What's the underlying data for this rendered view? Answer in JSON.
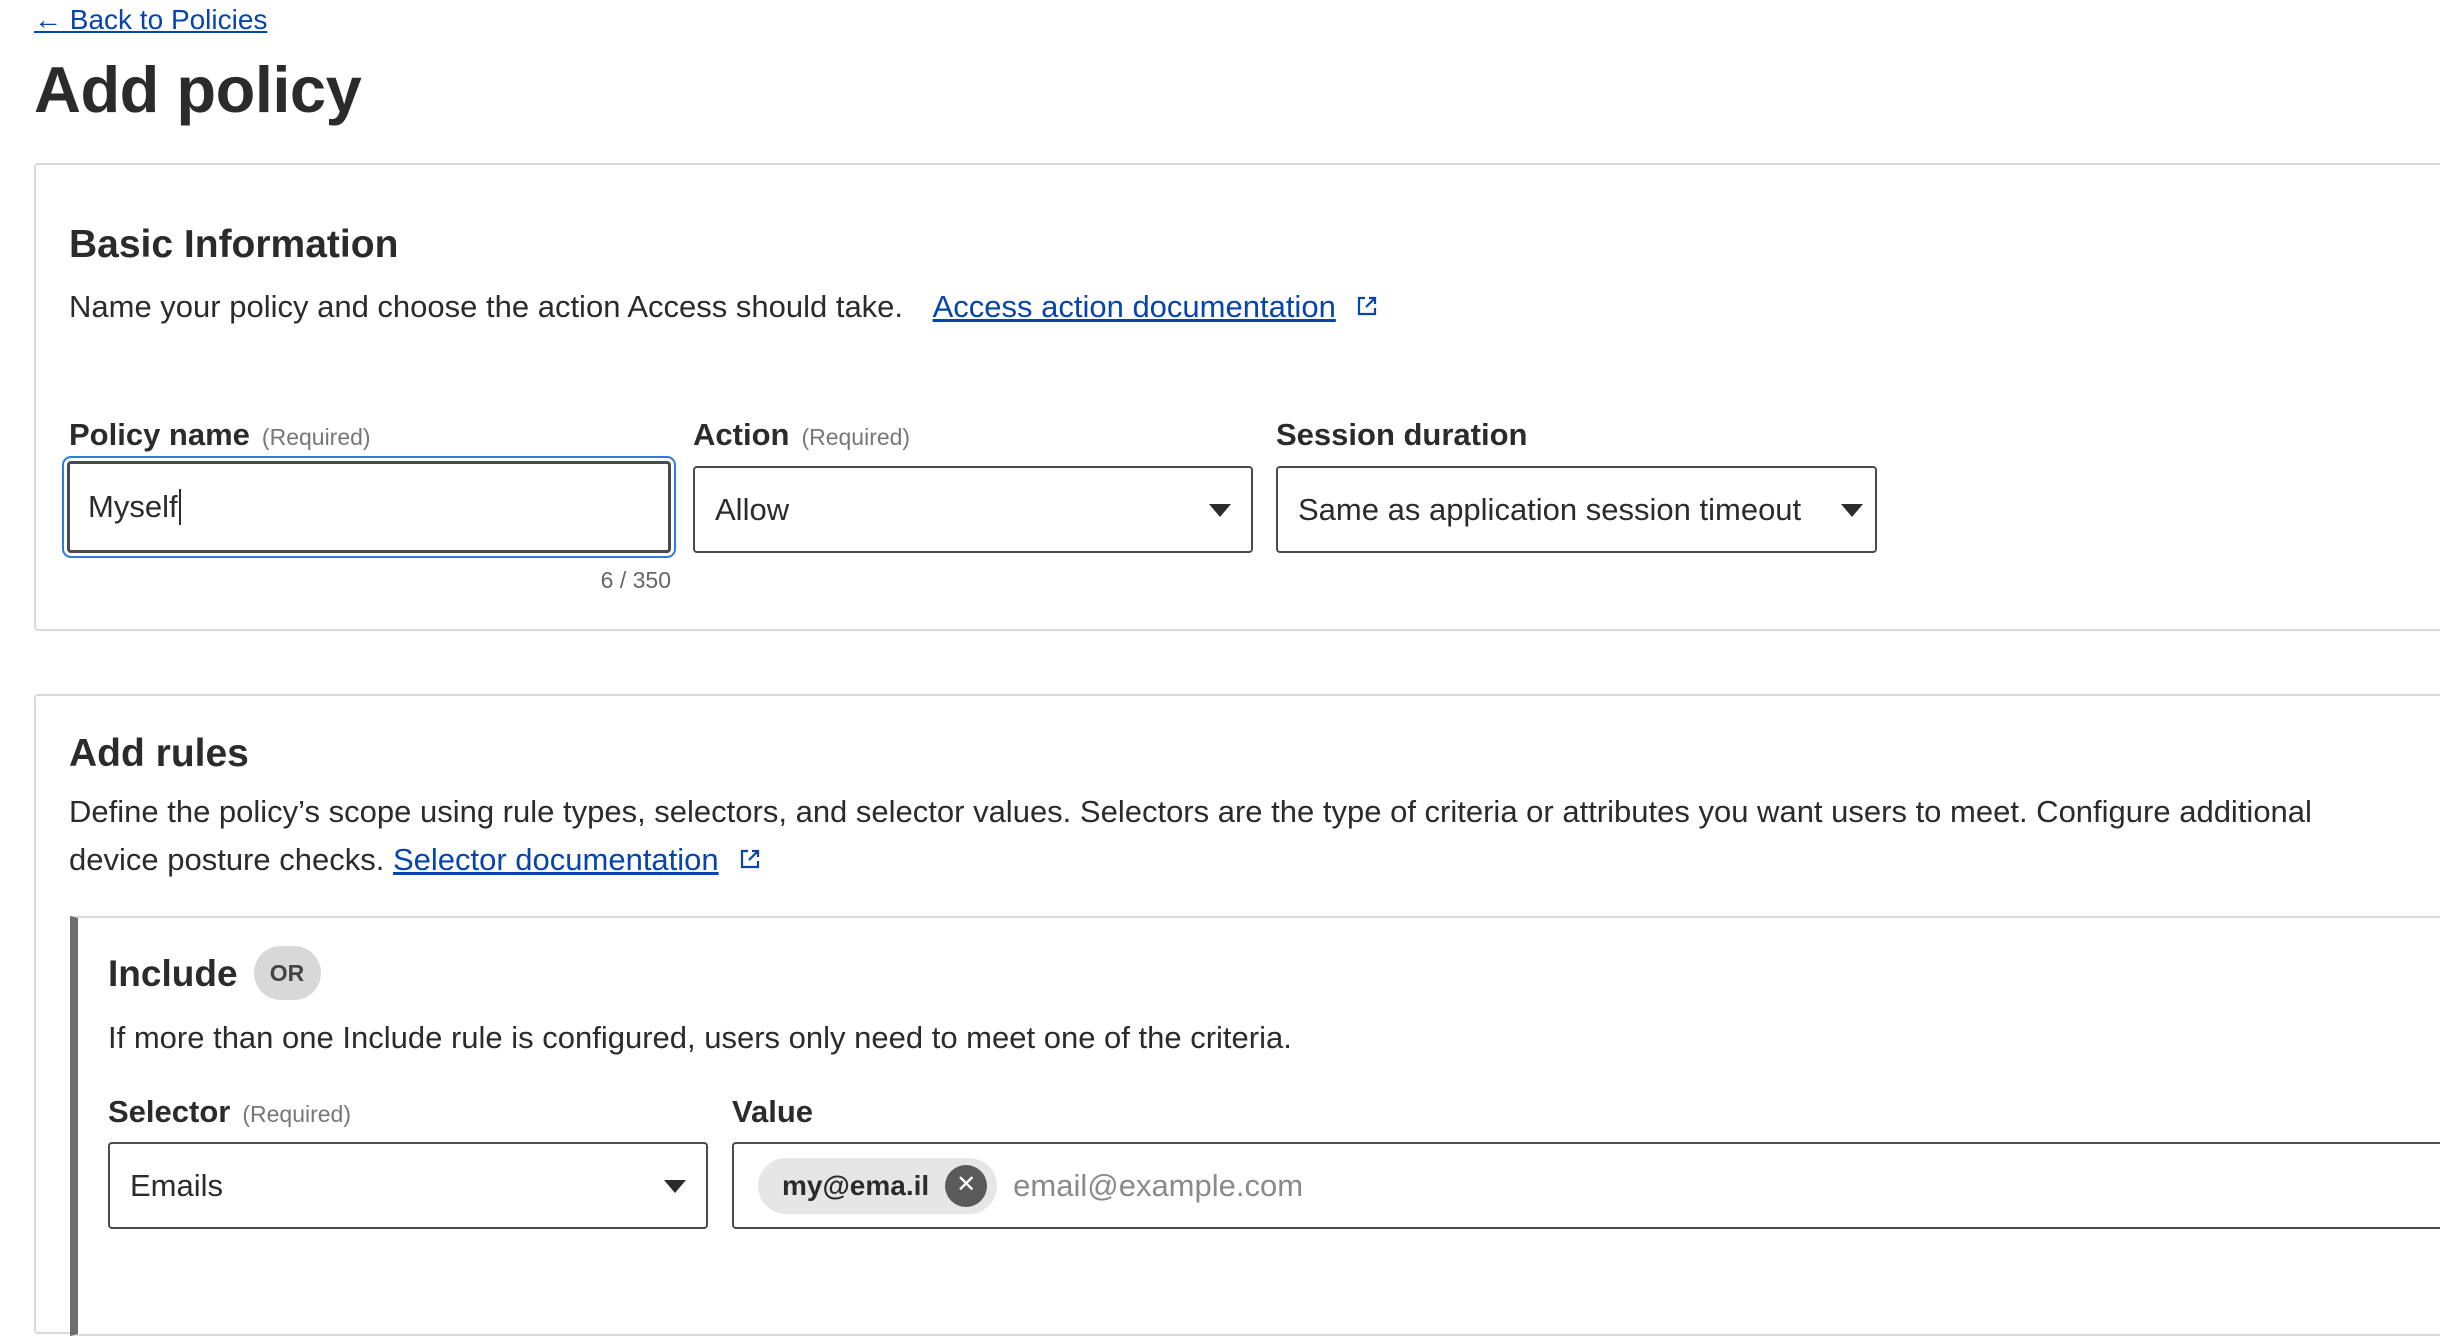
{
  "nav": {
    "back_label": "← Back to Policies"
  },
  "page": {
    "title": "Add policy"
  },
  "basic": {
    "title": "Basic Information",
    "description": "Name your policy and choose the action Access should take.",
    "doc_link": "Access action documentation",
    "policy_name_label": "Policy name",
    "policy_name_required": "(Required)",
    "policy_name_value": "Myself",
    "policy_name_counter": "6 / 350",
    "action_label": "Action",
    "action_required": "(Required)",
    "action_value": "Allow",
    "session_label": "Session duration",
    "session_value": "Same as application session timeout"
  },
  "rules": {
    "title": "Add rules",
    "description_line1": "Define the policy’s scope using rule types, selectors, and selector values. Selectors are the type of criteria or attributes you want users to meet. Configure additional",
    "description_line2": "device posture checks.",
    "doc_link": "Selector documentation",
    "include": {
      "title": "Include",
      "badge": "OR",
      "description": "If more than one Include rule is configured, users only need to meet one of the criteria.",
      "selector_label": "Selector",
      "selector_required": "(Required)",
      "selector_value": "Emails",
      "value_label": "Value",
      "chip_value": "my@ema.il",
      "value_placeholder": "email@example.com"
    }
  },
  "icons": {
    "external": "external-link-icon",
    "caret": "caret-down-icon",
    "remove": "close-icon"
  },
  "colors": {
    "link": "#0645ad",
    "focus": "#2c7be5",
    "include_bar": "#6d6d6d"
  }
}
